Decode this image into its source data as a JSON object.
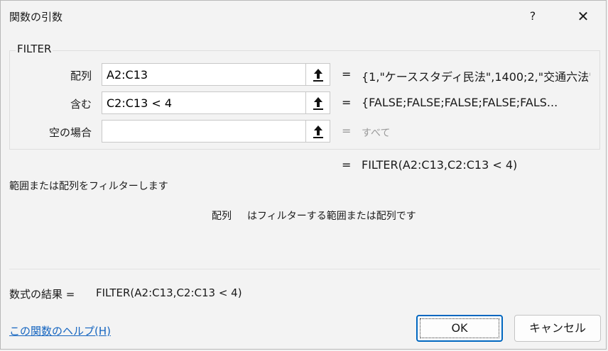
{
  "window": {
    "title": "関数の引数",
    "help_label": "?",
    "close_label": "✕"
  },
  "function": {
    "name": "FILTER"
  },
  "args": [
    {
      "label": "配列",
      "value": "A2:C13",
      "result": "{1,\"ケーススタディ民法\",1400;2,\"交通六法\"",
      "muted": false
    },
    {
      "label": "含む",
      "value": "C2:C13 < 4",
      "result": "{FALSE;FALSE;FALSE;FALSE;FALS...",
      "muted": false
    },
    {
      "label": "空の場合",
      "value": "",
      "result": "すべて",
      "muted": true
    }
  ],
  "equals_sign": "=",
  "formula_result": "FILTER(A2:C13,C2:C13 < 4)",
  "description": "範囲または配列をフィルターします",
  "arg_description": {
    "name": "配列",
    "text": "はフィルターする範囲または配列です"
  },
  "result": {
    "label": "数式の結果 =",
    "value": "FILTER(A2:C13,C2:C13 < 4)"
  },
  "help_link": "この関数のヘルプ(H)",
  "buttons": {
    "ok": "OK",
    "cancel": "キャンセル"
  }
}
